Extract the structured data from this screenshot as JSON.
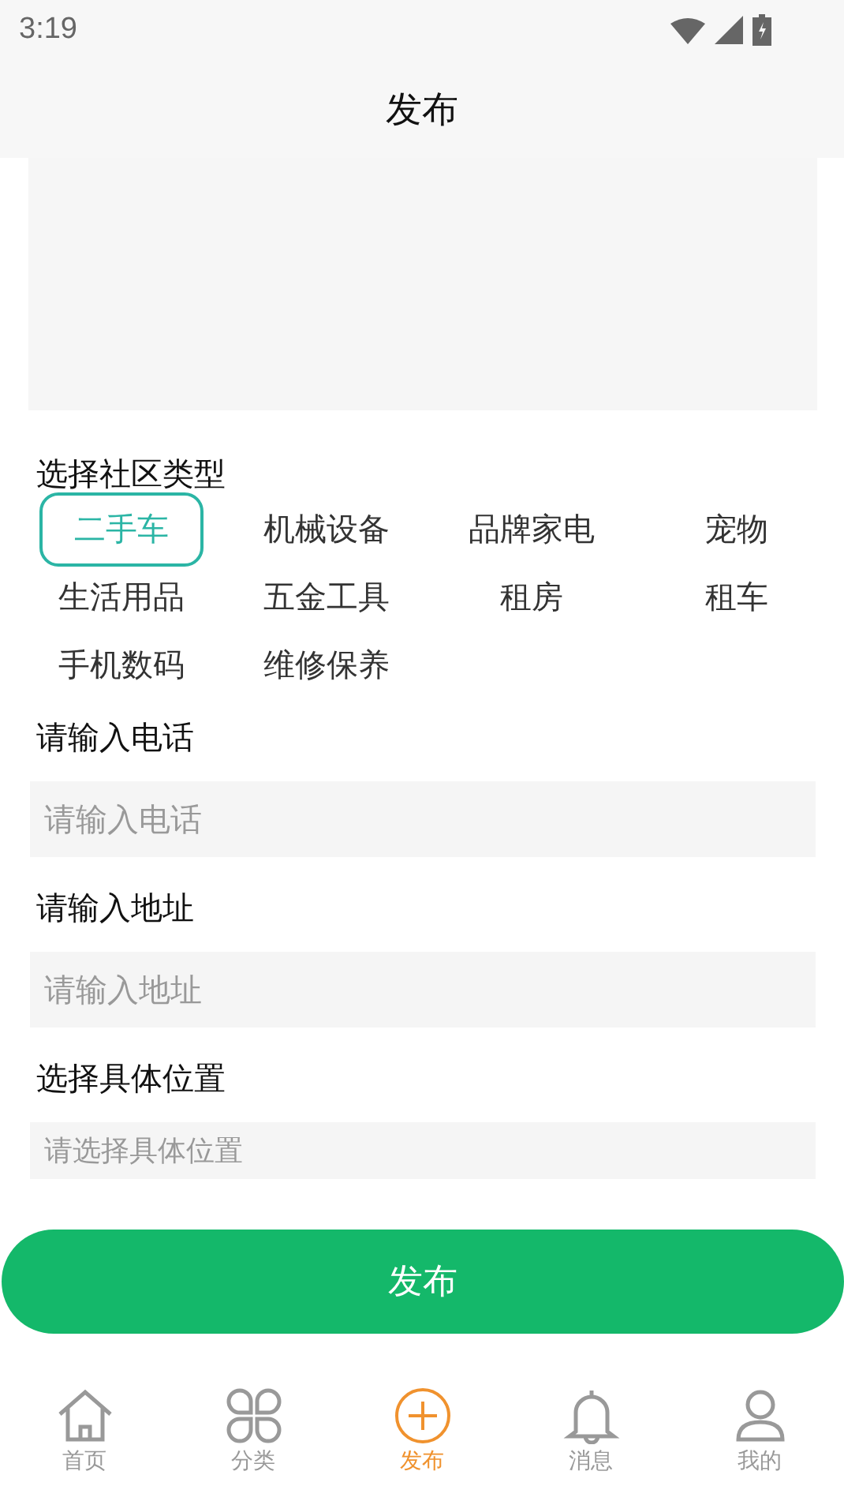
{
  "status_bar": {
    "time": "3:19"
  },
  "header": {
    "title": "发布"
  },
  "category_section": {
    "label": "选择社区类型",
    "options": [
      {
        "label": "二手车",
        "selected": true
      },
      {
        "label": "机械设备",
        "selected": false
      },
      {
        "label": "品牌家电",
        "selected": false
      },
      {
        "label": "宠物",
        "selected": false
      },
      {
        "label": "生活用品",
        "selected": false
      },
      {
        "label": "五金工具",
        "selected": false
      },
      {
        "label": "租房",
        "selected": false
      },
      {
        "label": "租车",
        "selected": false
      },
      {
        "label": "手机数码",
        "selected": false
      },
      {
        "label": "维修保养",
        "selected": false
      }
    ]
  },
  "fields": [
    {
      "label": "请输入电话",
      "placeholder": "请输入电话",
      "kind": "large"
    },
    {
      "label": "请输入地址",
      "placeholder": "请输入地址",
      "kind": "large"
    },
    {
      "label": "选择具体位置",
      "placeholder": "请选择具体位置",
      "kind": "small"
    }
  ],
  "submit_button": "发布",
  "tab_bar": [
    {
      "label": "首页",
      "selected": false
    },
    {
      "label": "分类",
      "selected": false
    },
    {
      "label": "发布",
      "selected": true
    },
    {
      "label": "消息",
      "selected": false
    },
    {
      "label": "我的",
      "selected": false
    }
  ]
}
